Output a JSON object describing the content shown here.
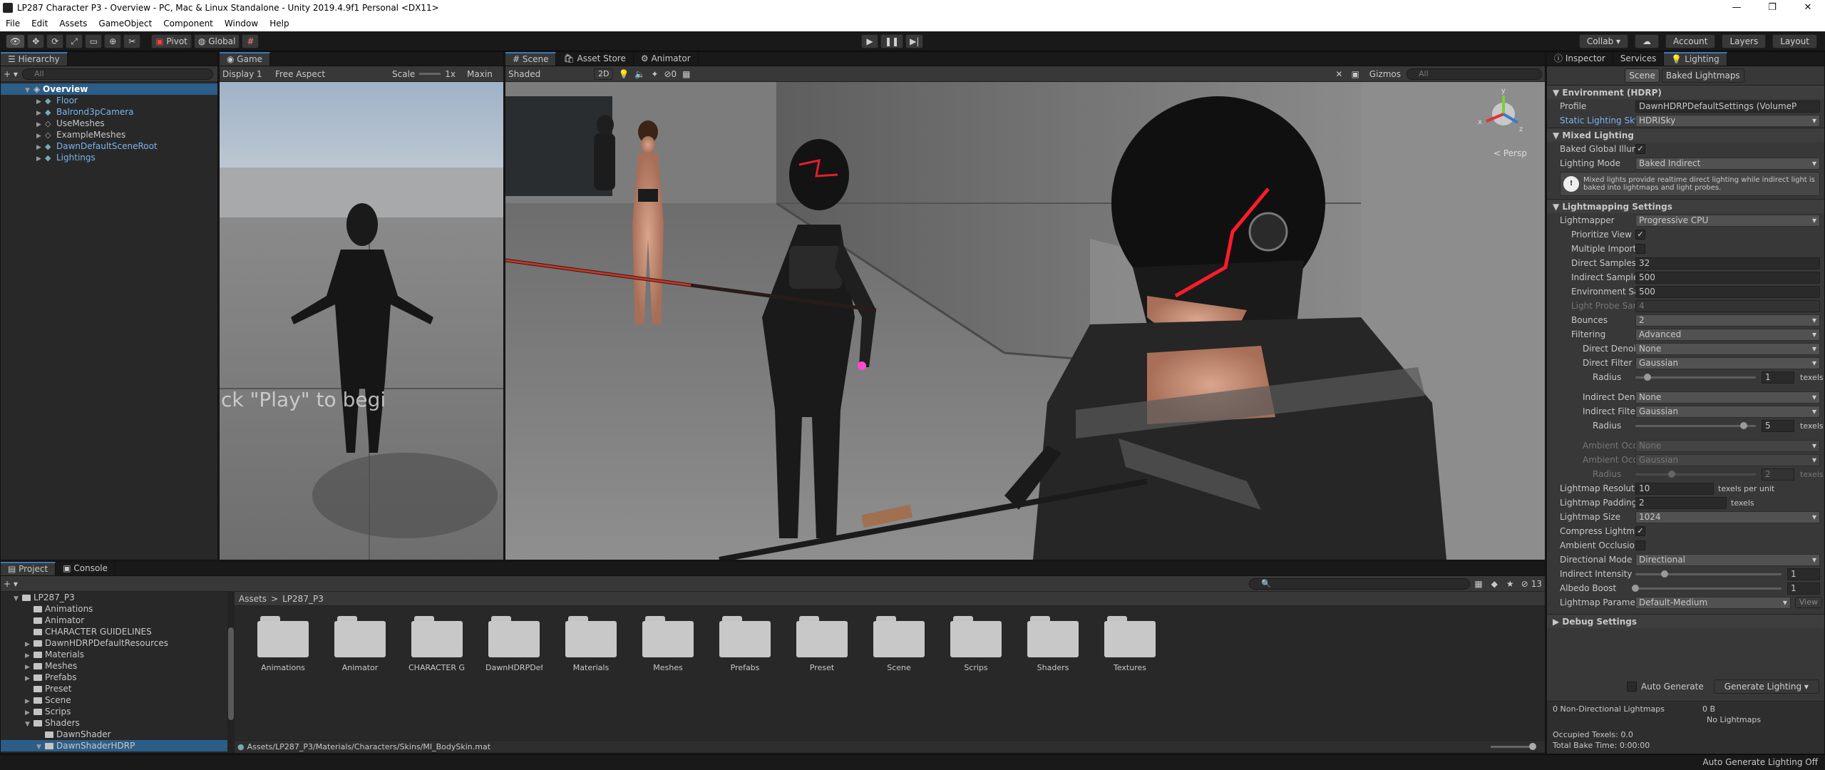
{
  "window": {
    "title": "LP287 Character P3 - Overview - PC, Mac & Linux Standalone - Unity 2019.4.9f1 Personal <DX11>"
  },
  "menu": [
    "File",
    "Edit",
    "Assets",
    "GameObject",
    "Component",
    "Window",
    "Help"
  ],
  "toolbar": {
    "pivot_label": "Pivot",
    "global_label": "Global",
    "collab_label": "Collab ▾",
    "account_label": "Account",
    "layers_label": "Layers",
    "layout_label": "Layout"
  },
  "hierarchy": {
    "tab": "Hierarchy",
    "search_placeholder": "All",
    "scene_name": "Overview",
    "items": [
      {
        "label": "Floor",
        "prefab": true
      },
      {
        "label": "Balrond3pCamera",
        "prefab": true
      },
      {
        "label": "UseMeshes",
        "prefab": false
      },
      {
        "label": "ExampleMeshes",
        "prefab": false
      },
      {
        "label": "DawnDefaultSceneRoot",
        "prefab": true
      },
      {
        "label": "Lightings",
        "prefab": true
      }
    ]
  },
  "game": {
    "tab": "Game",
    "display": "Display 1",
    "aspect": "Free Aspect",
    "scale_label": "Scale",
    "scale_value": "1x",
    "maximize": "Maxin",
    "overlay_text": "ck \"Play\" to begi"
  },
  "scene": {
    "tabs": [
      "Scene",
      "Asset Store",
      "Animator"
    ],
    "shading": "Shaded",
    "mode_2d": "2D",
    "gizmos_label": "Gizmos",
    "search_placeholder": "All",
    "persp_label": "< Persp",
    "hidden_count": "0"
  },
  "inspector": {
    "tabs": [
      "Inspector",
      "Services",
      "Lighting"
    ],
    "toggle_scene": "Scene",
    "toggle_baked": "Baked Lightmaps",
    "environment": {
      "header": "Environment (HDRP)",
      "profile_label": "Profile",
      "profile_value": "DawnHDRPDefaultSettings (VolumeP",
      "sky_label": "Static Lighting Sky",
      "sky_value": "HDRISky"
    },
    "mixed": {
      "header": "Mixed Lighting",
      "baked_gi_label": "Baked Global Illumina",
      "mode_label": "Lighting Mode",
      "mode_value": "Baked Indirect",
      "help": "Mixed lights provide realtime direct lighting while indirect light is baked into lightmaps and light probes."
    },
    "lightmapping": {
      "header": "Lightmapping Settings",
      "lightmapper_label": "Lightmapper",
      "lightmapper_value": "Progressive CPU",
      "prioritize_label": "Prioritize View",
      "multiple_label": "Multiple Importanc",
      "direct_samples_label": "Direct Samples",
      "direct_samples_value": "32",
      "indirect_samples_label": "Indirect Samples",
      "indirect_samples_value": "500",
      "env_samples_label": "Environment Samp",
      "env_samples_value": "500",
      "probe_label": "Light Probe Sampl",
      "probe_value": "4",
      "bounces_label": "Bounces",
      "bounces_value": "2",
      "filtering_label": "Filtering",
      "filtering_value": "Advanced",
      "direct_denoiser_label": "Direct Denoiser",
      "direct_denoiser_value": "None",
      "direct_filter_label": "Direct Filter",
      "direct_filter_value": "Gaussian",
      "radius_label": "Radius",
      "radius1_value": "1",
      "radius1_fraction": 0.1,
      "texels_label": "texels",
      "indirect_denoiser_label": "Indirect Denoise",
      "indirect_denoiser_value": "None",
      "indirect_filter_label": "Indirect Filter",
      "indirect_filter_value": "Gaussian",
      "radius2_value": "5",
      "radius2_fraction": 0.9,
      "ao_label": "Ambient Occlus",
      "ao_denoiser_value": "None",
      "ao_filter_value": "Gaussian",
      "radius3_value": "2",
      "radius3_fraction": 0.3,
      "resolution_label": "Lightmap Resolution",
      "resolution_value": "10",
      "resolution_unit": "texels per unit",
      "padding_label": "Lightmap Padding",
      "padding_value": "2",
      "size_label": "Lightmap Size",
      "size_value": "1024",
      "compress_label": "Compress Lightmaps",
      "ambient_occ_label": "Ambient Occlusion",
      "directional_label": "Directional Mode",
      "directional_value": "Directional",
      "indirect_intensity_label": "Indirect Intensity",
      "indirect_intensity_value": "1",
      "indirect_intensity_fraction": 0.2,
      "albedo_label": "Albedo Boost",
      "albedo_value": "1",
      "albedo_fraction": 0.0,
      "parameters_label": "Lightmap Parameters",
      "parameters_value": "Default-Medium",
      "view_label": "View"
    },
    "debug_header": "Debug Settings",
    "auto_generate_label": "Auto Generate",
    "generate_button": "Generate Lighting",
    "stats": {
      "non_directional": "0 Non-Directional Lightmaps",
      "size": "0 B",
      "no_lightmaps": "No Lightmaps",
      "occupied": "Occupied Texels: 0.0",
      "bake_time": "Total Bake Time: 0:00:00"
    }
  },
  "project": {
    "tabs": [
      "Project",
      "Console"
    ],
    "root": "LP287_P3",
    "tree": [
      {
        "label": "Animations",
        "depth": 1,
        "arrow": ""
      },
      {
        "label": "Animator",
        "depth": 1,
        "arrow": ""
      },
      {
        "label": "CHARACTER GUIDELINES",
        "depth": 1,
        "arrow": ""
      },
      {
        "label": "DawnHDRPDefaultResources",
        "depth": 1,
        "arrow": "▶"
      },
      {
        "label": "Materials",
        "depth": 1,
        "arrow": "▶"
      },
      {
        "label": "Meshes",
        "depth": 1,
        "arrow": "▶"
      },
      {
        "label": "Prefabs",
        "depth": 1,
        "arrow": "▶"
      },
      {
        "label": "Preset",
        "depth": 1,
        "arrow": ""
      },
      {
        "label": "Scene",
        "depth": 1,
        "arrow": "▶"
      },
      {
        "label": "Scrips",
        "depth": 1,
        "arrow": "▶"
      },
      {
        "label": "Shaders",
        "depth": 1,
        "arrow": "▼"
      },
      {
        "label": "DawnShader",
        "depth": 2,
        "arrow": ""
      },
      {
        "label": "DawnShaderHDRP",
        "depth": 2,
        "arrow": "▼"
      }
    ],
    "breadcrumb_root": "Assets",
    "breadcrumb_sep": ">",
    "breadcrumb_current": "LP287_P3",
    "folders": [
      "Animations",
      "Animator",
      "CHARACTER GUI...",
      "DawnHDRPDefaul...",
      "Materials",
      "Meshes",
      "Prefabs",
      "Preset",
      "Scene",
      "Scrips",
      "Shaders",
      "Textures"
    ],
    "selected_path": "Assets/LP287_P3/Materials/Characters/Skins/MI_BodySkin.mat",
    "count": "13"
  },
  "status": {
    "right": "Auto Generate Lighting Off"
  }
}
